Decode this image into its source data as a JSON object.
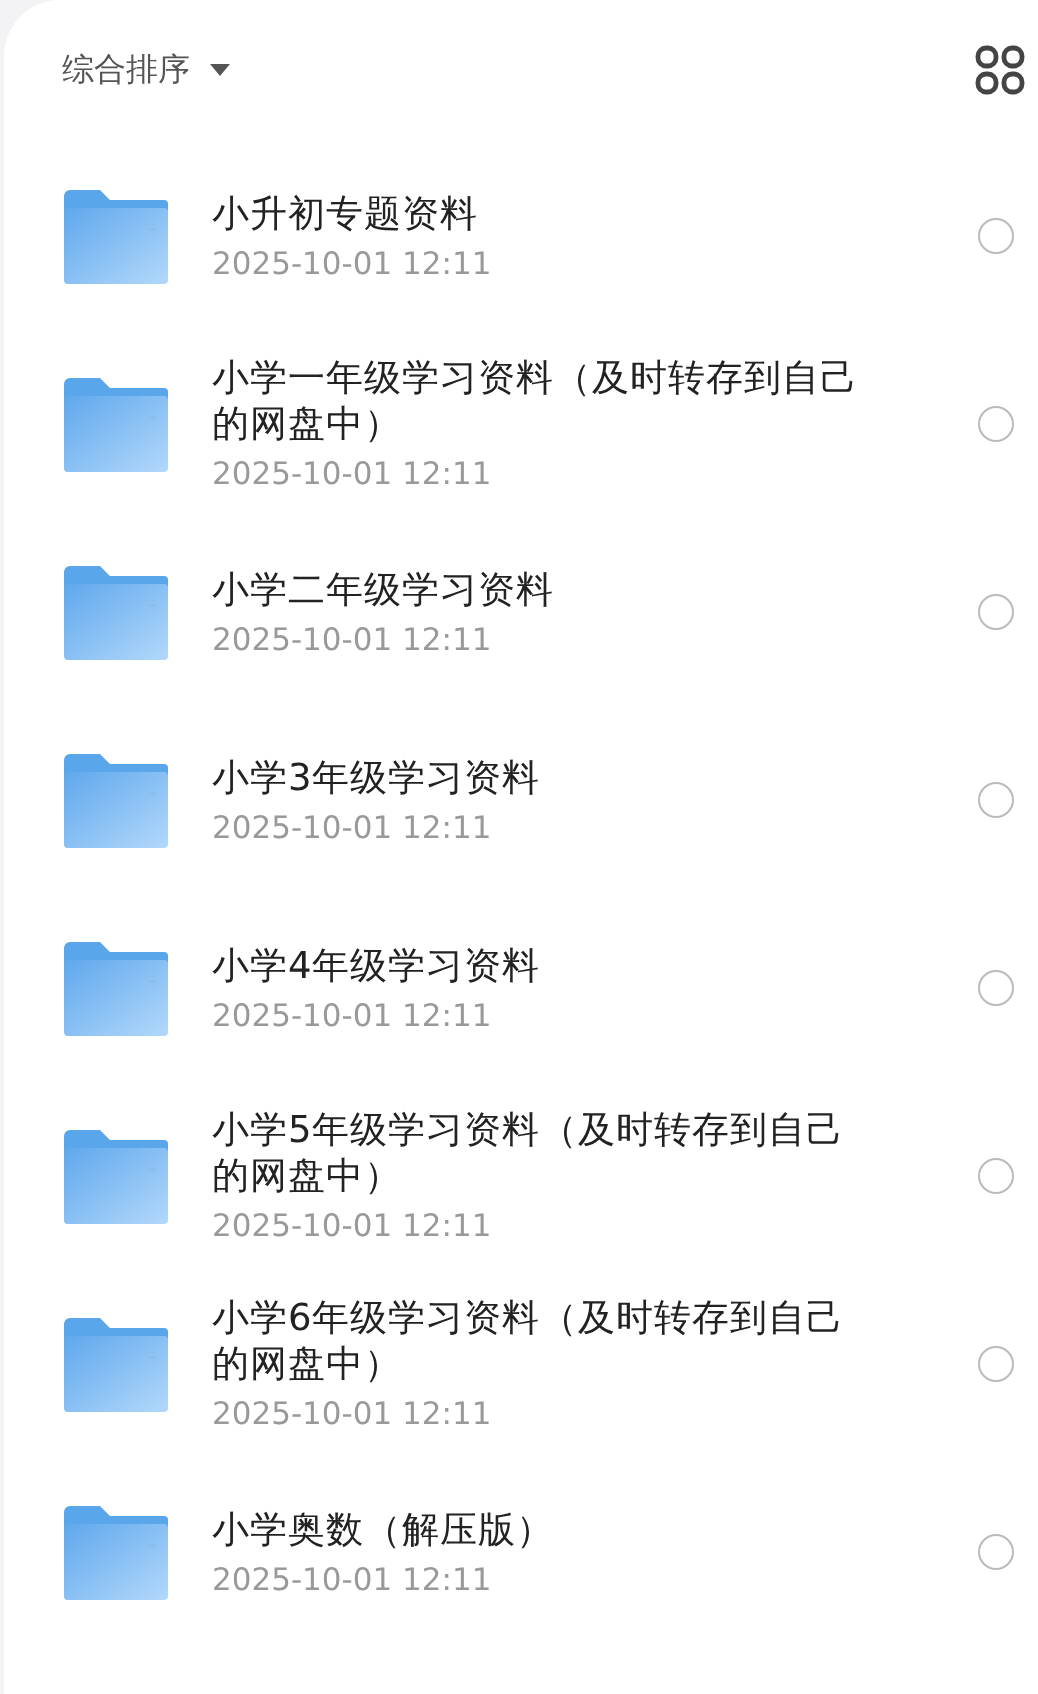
{
  "toolbar": {
    "sort_label": "综合排序"
  },
  "files": [
    {
      "name": "小升初专题资料",
      "date": "2025-10-01 12:11",
      "selected": false
    },
    {
      "name": "小学一年级学习资料（及时转存到自己的网盘中）",
      "date": "2025-10-01 12:11",
      "selected": false
    },
    {
      "name": "小学二年级学习资料",
      "date": "2025-10-01 12:11",
      "selected": false
    },
    {
      "name": "小学3年级学习资料",
      "date": "2025-10-01 12:11",
      "selected": false
    },
    {
      "name": "小学4年级学习资料",
      "date": "2025-10-01 12:11",
      "selected": false
    },
    {
      "name": "小学5年级学习资料（及时转存到自己的网盘中）",
      "date": "2025-10-01 12:11",
      "selected": false
    },
    {
      "name": "小学6年级学习资料（及时转存到自己的网盘中）",
      "date": "2025-10-01 12:11",
      "selected": false
    },
    {
      "name": "小学奥数（解压版）",
      "date": "2025-10-01 12:11",
      "selected": false
    }
  ]
}
